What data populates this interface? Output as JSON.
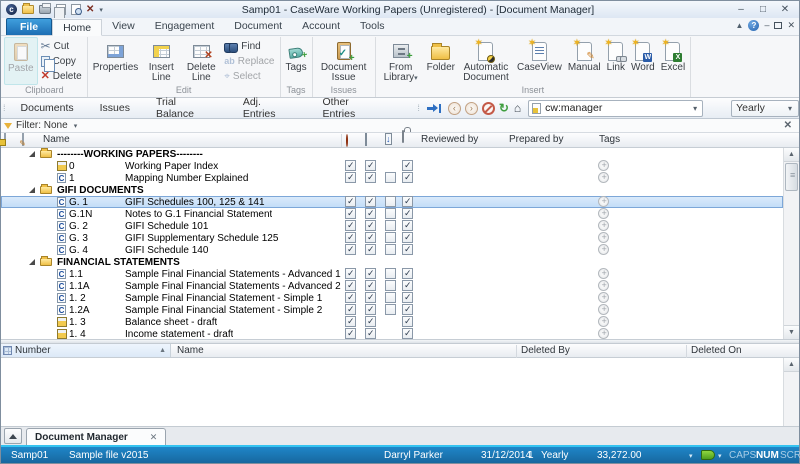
{
  "titlebar": {
    "title": "Samp01 - CaseWare Working Papers (Unregistered) - [Document Manager]"
  },
  "tabs": {
    "file": "File",
    "items": [
      "Home",
      "View",
      "Engagement",
      "Document",
      "Account",
      "Tools"
    ]
  },
  "ribbon": {
    "clipboard": {
      "label": "Clipboard",
      "paste": "Paste",
      "cut": "Cut",
      "copy": "Copy",
      "delete": "Delete"
    },
    "edit": {
      "label": "Edit",
      "properties": "Properties",
      "insert_line": "Insert Line",
      "delete_line": "Delete Line",
      "find": "Find",
      "replace": "Replace",
      "select": "Select"
    },
    "tags_group": {
      "label": "Tags",
      "tags": "Tags"
    },
    "issues": {
      "label": "Issues",
      "document_issue": "Document Issue"
    },
    "insert": {
      "label": "Insert",
      "from_library": "From Library",
      "folder": "Folder",
      "automatic_document": "Automatic Document",
      "caseview": "CaseView",
      "manual": "Manual",
      "link": "Link",
      "word": "Word",
      "excel": "Excel"
    }
  },
  "navbar": {
    "documents": "Documents",
    "issues": "Issues",
    "trial_balance": "Trial Balance",
    "adj_entries": "Adj. Entries",
    "other_entries": "Other Entries",
    "address": "cw:manager",
    "period": "Yearly"
  },
  "filterbar": {
    "label": "Filter: None"
  },
  "doclist": {
    "headers": {
      "name": "Name",
      "reviewed_by": "Reviewed by",
      "prepared_by": "Prepared by",
      "tags": "Tags"
    },
    "rows": [
      {
        "type": "folder",
        "name": "--------WORKING PAPERS--------"
      },
      {
        "type": "doc",
        "icon": "book",
        "number": "0",
        "name": "Working Paper Index",
        "checks": [
          "c",
          "c",
          "n",
          "c"
        ],
        "tags": true
      },
      {
        "type": "doc",
        "icon": "cv",
        "number": "1",
        "name": "Mapping Number Explained",
        "checks": [
          "c",
          "c",
          "u",
          "c"
        ],
        "tags": true
      },
      {
        "type": "folder",
        "name": "GIFI DOCUMENTS"
      },
      {
        "type": "doc",
        "icon": "cv",
        "number": "G. 1",
        "name": "GIFI Schedules 100, 125 & 141",
        "checks": [
          "c",
          "c",
          "u",
          "c"
        ],
        "tags": true,
        "selected": true
      },
      {
        "type": "doc",
        "icon": "cv",
        "number": "G.1N",
        "name": "Notes to G.1 Financial Statement",
        "checks": [
          "c",
          "c",
          "u",
          "c"
        ],
        "tags": true
      },
      {
        "type": "doc",
        "icon": "cv",
        "number": "G. 2",
        "name": "GIFI Schedule 101",
        "checks": [
          "c",
          "c",
          "u",
          "c"
        ],
        "tags": true
      },
      {
        "type": "doc",
        "icon": "cv",
        "number": "G. 3",
        "name": "GIFI Supplementary Schedule 125",
        "checks": [
          "c",
          "c",
          "u",
          "c"
        ],
        "tags": true
      },
      {
        "type": "doc",
        "icon": "cv",
        "number": "G. 4",
        "name": "GIFI Schedule 140",
        "checks": [
          "c",
          "c",
          "u",
          "c"
        ],
        "tags": true
      },
      {
        "type": "folder",
        "name": "FINANCIAL STATEMENTS"
      },
      {
        "type": "doc",
        "icon": "cv",
        "number": "1.1",
        "name": "Sample Final Financial Statements - Advanced 1",
        "checks": [
          "c",
          "c",
          "u",
          "c"
        ],
        "tags": true
      },
      {
        "type": "doc",
        "icon": "cv",
        "number": "1.1A",
        "name": "Sample Final Financial Statements - Advanced 2",
        "checks": [
          "c",
          "c",
          "u",
          "c"
        ],
        "tags": true
      },
      {
        "type": "doc",
        "icon": "cv",
        "number": "1. 2",
        "name": "Sample Final Financial Statement - Simple 1",
        "checks": [
          "c",
          "c",
          "u",
          "c"
        ],
        "tags": true
      },
      {
        "type": "doc",
        "icon": "cv",
        "number": "1.2A",
        "name": "Sample Final Financial Statement - Simple 2",
        "checks": [
          "c",
          "c",
          "u",
          "c"
        ],
        "tags": true
      },
      {
        "type": "doc",
        "icon": "book",
        "number": "1. 3",
        "name": "Balance sheet - draft",
        "checks": [
          "c",
          "c",
          "n",
          "c"
        ],
        "tags": true
      },
      {
        "type": "doc",
        "icon": "book",
        "number": "1. 4",
        "name": "Income statement - draft",
        "checks": [
          "c",
          "c",
          "n",
          "c"
        ],
        "tags": true
      }
    ]
  },
  "bottom_panel": {
    "headers": {
      "number": "Number",
      "name": "Name",
      "deleted_by": "Deleted By",
      "deleted_on": "Deleted On"
    }
  },
  "tabbar": {
    "document_manager": "Document Manager"
  },
  "statusbar": {
    "client": "Samp01",
    "file": "Sample file v2015",
    "user": "Darryl Parker",
    "date": "31/12/2014",
    "period_num": "1",
    "period": "Yearly",
    "amount": "33,272.00",
    "caps": "CAPS",
    "num": "NUM",
    "scrl": "SCRL"
  }
}
